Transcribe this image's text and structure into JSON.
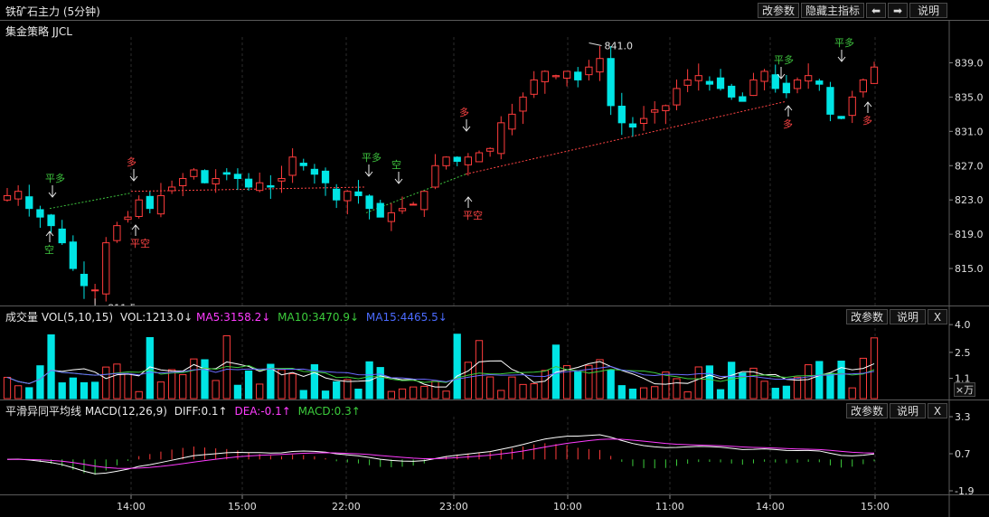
{
  "window": {
    "title": "铁矿石主力 (5分钟)",
    "buttons": [
      "改参数",
      "隐藏主指标",
      "⬅",
      "➡",
      "说明"
    ]
  },
  "strategy": {
    "label": "集金策略 JJCL"
  },
  "main": {
    "y_ticks": [
      "839.0",
      "835.0",
      "831.0",
      "827.0",
      "823.0",
      "819.0",
      "815.0"
    ],
    "high_label": "841.0",
    "low_label": "811.5",
    "signals": [
      {
        "text": "平多",
        "color": "#3ec43e"
      },
      {
        "text": "空",
        "color": "#3ec43e"
      },
      {
        "text": "多",
        "color": "#ff4444"
      },
      {
        "text": "平空",
        "color": "#ff4444"
      },
      {
        "text": "平多",
        "color": "#3ec43e"
      },
      {
        "text": "空",
        "color": "#3ec43e"
      },
      {
        "text": "多",
        "color": "#ff4444"
      },
      {
        "text": "平空",
        "color": "#ff4444"
      },
      {
        "text": "平多",
        "color": "#3ec43e"
      },
      {
        "text": "多",
        "color": "#ff4444"
      },
      {
        "text": "平多",
        "color": "#3ec43e"
      },
      {
        "text": "多",
        "color": "#ff4444"
      }
    ]
  },
  "volume": {
    "title": "成交量 VOL(5,10,15)",
    "vol": "VOL:1213.0↓",
    "ma5": "MA5:3158.2↓",
    "ma10": "MA10:3470.9↓",
    "ma15": "MA15:4465.5↓",
    "buttons": [
      "改参数",
      "说明",
      "X"
    ],
    "y_ticks": [
      "4.0",
      "2.5",
      "1.1"
    ],
    "unit": "×万"
  },
  "macd": {
    "title": "平滑异同平均线 MACD(12,26,9)",
    "diff": "DIFF:0.1↑",
    "dea": "DEA:-0.1↑",
    "macd": "MACD:0.3↑",
    "buttons": [
      "改参数",
      "说明",
      "X"
    ],
    "y_ticks": [
      "3.3",
      "0.7",
      "-1.9"
    ]
  },
  "x_axis": [
    "14:00",
    "15:00",
    "22:00",
    "23:00",
    "10:00",
    "11:00",
    "14:00",
    "15:00"
  ],
  "colors": {
    "up": "#ff3c3c",
    "down": "#00e5e5",
    "vol_ma5": "#ffffff",
    "vol_ma10": "#3ccc3c",
    "vol_ma15": "#6a6aff",
    "diff": "#ffffff",
    "dea": "#ff3cff"
  },
  "chart_data": {
    "type": "candlestick",
    "series": [
      {
        "close": [
          823.5,
          824.0,
          822.0,
          821.0,
          820.0,
          818.0,
          815.0,
          813.0,
          812.5,
          818.0,
          820.0,
          821.0,
          823.0,
          822.0,
          823.5,
          824.5,
          825.5,
          826.5,
          825.0,
          825.5,
          826.0,
          825.5,
          824.5,
          825.0,
          824.5,
          825.5,
          828.0,
          827.0,
          826.0,
          825.0,
          823.0,
          824.0,
          823.5,
          822.0,
          821.0,
          821.5,
          822.0,
          822.5,
          824.0,
          827.0,
          828.0,
          827.5,
          828.0,
          828.5,
          829.0,
          832.0,
          833.0,
          835.0,
          837.0,
          838.0,
          837.5,
          838.0,
          837.0,
          838.5,
          839.5,
          834.0,
          832.0,
          831.5,
          832.5,
          833.5,
          834.0,
          836.0,
          837.0,
          837.5,
          836.5,
          836.0,
          835.0,
          834.5,
          837.0,
          838.0,
          836.0,
          835.5,
          837.0,
          837.5,
          836.5,
          833.0,
          832.5,
          835.0,
          837.0,
          838.5
        ]
      }
    ],
    "x_ticks": [
      "14:00",
      "15:00",
      "22:00",
      "23:00",
      "10:00",
      "11:00",
      "14:00",
      "15:00"
    ],
    "y_ticks": [
      815.0,
      819.0,
      823.0,
      827.0,
      831.0,
      835.0,
      839.0
    ],
    "ylim": [
      811.0,
      842.0
    ],
    "high": 841.0,
    "low": 811.5
  }
}
